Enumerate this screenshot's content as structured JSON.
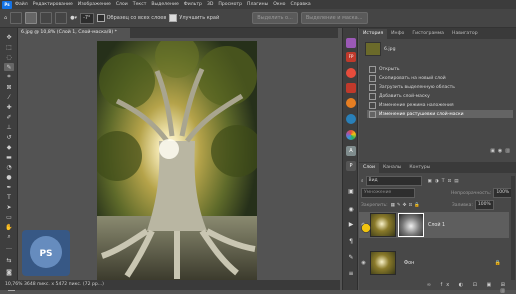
{
  "menubar": {
    "logo_text": "Ps",
    "items": [
      "Файл",
      "Редактирование",
      "Изображение",
      "Слои",
      "Текст",
      "Выделение",
      "Фильтр",
      "3D",
      "Просмотр",
      "Плагины",
      "Окно",
      "Справка"
    ]
  },
  "options": {
    "blend_opacity": "-7°",
    "sample_all_layers": "Образец со всех слоев",
    "enhance_edge": "Улучшить край",
    "select_subject": "Выделить о...",
    "select_and_mask": "Выделение и маска..."
  },
  "document": {
    "tab_title": "6.jpg @ 10,8% (Слой 1, Слой-маска/8) *",
    "status": "10,76%   3648 пикс. x 5472 пикс. (72 рр...)"
  },
  "watermark": {
    "logo_text": "PS"
  },
  "history_panel": {
    "tabs": [
      "История",
      "Инфо",
      "Гистограмма",
      "Навигатор"
    ],
    "snapshot": "6.jpg",
    "items": [
      "Открыть",
      "Скопировать на новый слой",
      "Загрузить выделенную область",
      "Добавить слой-маску",
      "Изменение режима наложения",
      "Изменение растушевки слой-маски"
    ],
    "selected_index": 5
  },
  "layers_panel": {
    "tabs": [
      "Слои",
      "Каналы",
      "Контуры"
    ],
    "filter": "Вид",
    "blend_mode": "Умножение",
    "opacity_label": "Непрозрачность:",
    "opacity_value": "100%",
    "lock_label": "Закрепить:",
    "fill_label": "Заливка:",
    "fill_value": "100%",
    "layers": [
      {
        "name": "Слой 1",
        "selected": true,
        "has_mask": true
      },
      {
        "name": "Фон",
        "selected": false,
        "has_mask": false
      }
    ]
  },
  "dock_icons": [
    {
      "name": "ai-icon",
      "color": "#9b59b6",
      "label": ""
    },
    {
      "name": "fp-icon",
      "color": "#c0392b",
      "label": "FP"
    },
    {
      "name": "stop-icon",
      "color": "#e74c3c",
      "label": ""
    },
    {
      "name": "red-icon",
      "color": "#c0392b",
      "label": ""
    },
    {
      "name": "orange-icon",
      "color": "#e67e22",
      "label": ""
    },
    {
      "name": "blue-circle-icon",
      "color": "#2980b9",
      "label": ""
    },
    {
      "name": "color-wheel-icon",
      "color": "#27ae60",
      "label": ""
    },
    {
      "name": "a-icon",
      "color": "#7f8c8d",
      "label": "A"
    },
    {
      "name": "p-icon",
      "color": "#555555",
      "label": "P"
    }
  ],
  "colors": {
    "accent": "#1473e6",
    "panel_bg": "#484848",
    "menubar_bg": "#3c3c3c"
  }
}
